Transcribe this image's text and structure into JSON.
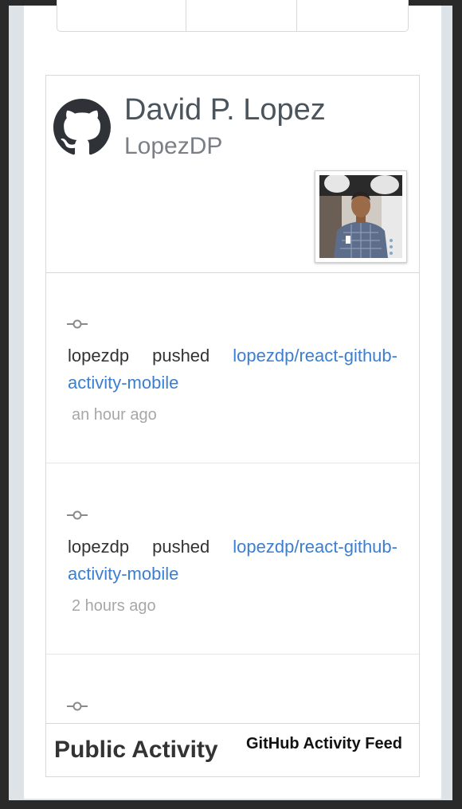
{
  "profile": {
    "name": "David P. Lopez",
    "login": "LopezDP",
    "logo_icon": "github-octocat-icon",
    "avatar_alt": "profile photo"
  },
  "events": [
    {
      "actor": "lopezdp",
      "verb": "pushed",
      "repo": "lopezdp/react-github-activity-mobile",
      "time": "an hour ago",
      "icon": "git-commit-icon"
    },
    {
      "actor": "lopezdp",
      "verb": "pushed",
      "repo": "lopezdp/react-github-activity-mobile",
      "time": "2 hours ago",
      "icon": "git-commit-icon"
    },
    {
      "icon": "git-commit-icon"
    }
  ],
  "footer": {
    "title": "Public Activity",
    "subtitle": "GitHub Activity Feed"
  },
  "colors": {
    "link": "#3b7fd0",
    "text": "#333333",
    "muted": "#a7a7a7",
    "border": "#d8d8d8",
    "backdrop": "#dde3e6"
  }
}
